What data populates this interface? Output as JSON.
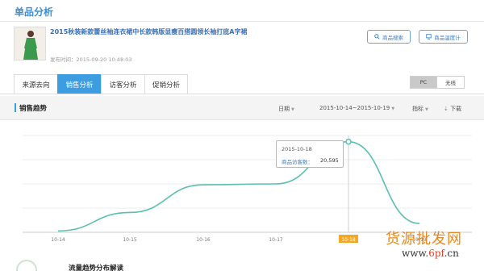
{
  "page": {
    "title": "单品分析"
  },
  "product": {
    "name": "2015秋装新款蕾丝袖连衣裙中长款韩版显瘦百搭圆领长袖打底A字裙",
    "publish_time": "发布时间：2015-09-20 10:48:03"
  },
  "actions": {
    "search_label": "商品搜索",
    "monitor_label": "商品温度计"
  },
  "tabs": [
    {
      "label": "来源去向",
      "active": false
    },
    {
      "label": "销售分析",
      "active": true
    },
    {
      "label": "访客分析",
      "active": false
    },
    {
      "label": "促销分析",
      "active": false
    }
  ],
  "device": {
    "pc_label": "PC",
    "wireless_label": "无线",
    "selected": "PC"
  },
  "section": {
    "title": "销售趋势",
    "date_label": "日期",
    "date_range": "2015-10-14~2015-10-19",
    "metric_label": "指标",
    "download_label": "下载"
  },
  "tooltip": {
    "date": "2015-10-18",
    "label": "商品访客数：",
    "value": "20,595"
  },
  "next_section": {
    "title": "流量趋势分布解读"
  },
  "watermark": {
    "text": "货源批发网",
    "site_prefix": "www.",
    "site_main": "6pf",
    "site_suffix": ".cn"
  },
  "colors": {
    "accent": "#3c9ee0",
    "line": "#5bbfb1",
    "highlight_tick": "#f5a623"
  },
  "chart_data": {
    "type": "line",
    "x": [
      "10-14",
      "10-15",
      "10-16",
      "10-17",
      "10-18",
      "10-19"
    ],
    "highlight_x": "10-18",
    "series": [
      {
        "values": [
          300,
          4500,
          10800,
          11000,
          20595,
          2000
        ]
      }
    ],
    "ylim": [
      0,
      22000
    ],
    "grid": true
  }
}
